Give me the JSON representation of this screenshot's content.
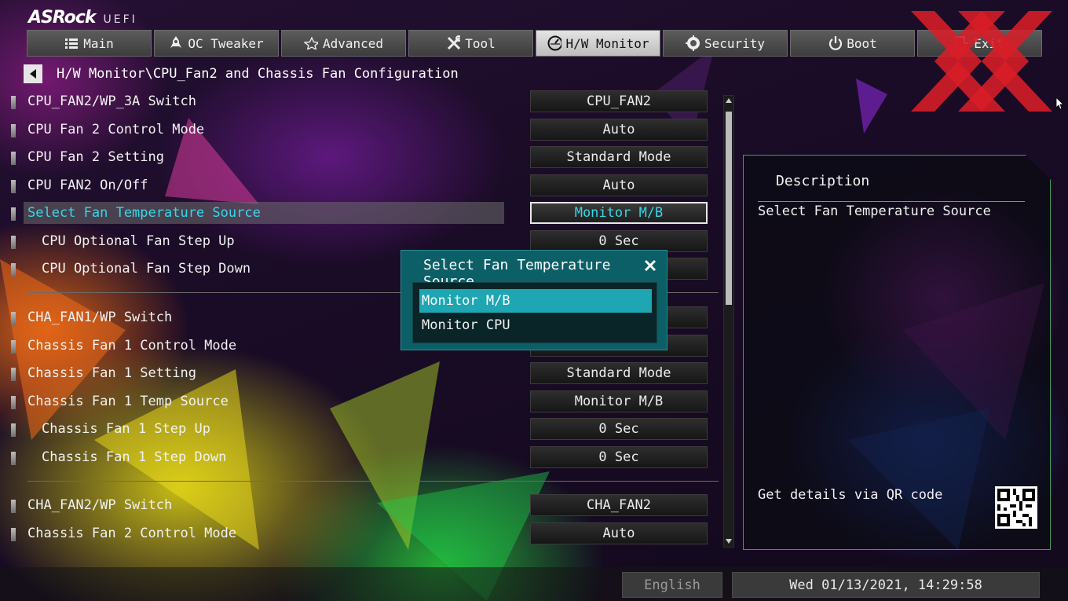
{
  "brand": {
    "name": "ASRock",
    "sub": "UEFI"
  },
  "tabs": [
    {
      "label": "Main",
      "icon": "list-icon"
    },
    {
      "label": "OC Tweaker",
      "icon": "rocket-icon"
    },
    {
      "label": "Advanced",
      "icon": "star-icon"
    },
    {
      "label": "Tool",
      "icon": "tools-icon"
    },
    {
      "label": "H/W Monitor",
      "icon": "monitor-gauge-icon"
    },
    {
      "label": "Security",
      "icon": "shield-gear-icon"
    },
    {
      "label": "Boot",
      "icon": "power-icon"
    },
    {
      "label": "Exit",
      "icon": "exit-icon"
    }
  ],
  "active_tab": "H/W Monitor",
  "breadcrumb": "H/W Monitor\\CPU_Fan2 and Chassis Fan Configuration",
  "settings": [
    {
      "label": "CPU_FAN2/WP_3A Switch",
      "value": "CPU_FAN2"
    },
    {
      "label": "CPU Fan 2 Control Mode",
      "value": "Auto"
    },
    {
      "label": "CPU Fan 2 Setting",
      "value": "Standard Mode"
    },
    {
      "label": "CPU FAN2 On/Off",
      "value": "Auto"
    },
    {
      "label": "Select Fan Temperature Source",
      "value": "Monitor M/B"
    },
    {
      "label": "CPU Optional Fan Step Up",
      "value": "0 Sec"
    },
    {
      "label": "CPU Optional Fan Step Down",
      "value": ""
    },
    {
      "label": "CHA_FAN1/WP Switch",
      "value": ""
    },
    {
      "label": "Chassis Fan 1 Control Mode",
      "value": "Auto"
    },
    {
      "label": "Chassis Fan 1 Setting",
      "value": "Standard Mode"
    },
    {
      "label": "Chassis Fan 1 Temp Source",
      "value": "Monitor M/B"
    },
    {
      "label": "Chassis Fan 1 Step Up",
      "value": "0 Sec"
    },
    {
      "label": "Chassis Fan 1 Step Down",
      "value": "0 Sec"
    },
    {
      "label": "CHA_FAN2/WP Switch",
      "value": "CHA_FAN2"
    },
    {
      "label": "Chassis Fan 2 Control Mode",
      "value": "Auto"
    }
  ],
  "description": {
    "title": "Description",
    "text": "Select Fan Temperature Source",
    "qr_label": "Get details via QR code"
  },
  "popup": {
    "title": "Select Fan Temperature Source",
    "options": [
      "Monitor M/B",
      "Monitor CPU"
    ],
    "selected": "Monitor M/B"
  },
  "footer": {
    "language": "English",
    "datetime": "Wed 01/13/2021, 14:29:58"
  },
  "colors": {
    "accent_cyan": "#34d8e8",
    "popup_teal": "#0c5f66",
    "panel_border": "#3fa05a",
    "watermark_red": "#d81e28"
  }
}
